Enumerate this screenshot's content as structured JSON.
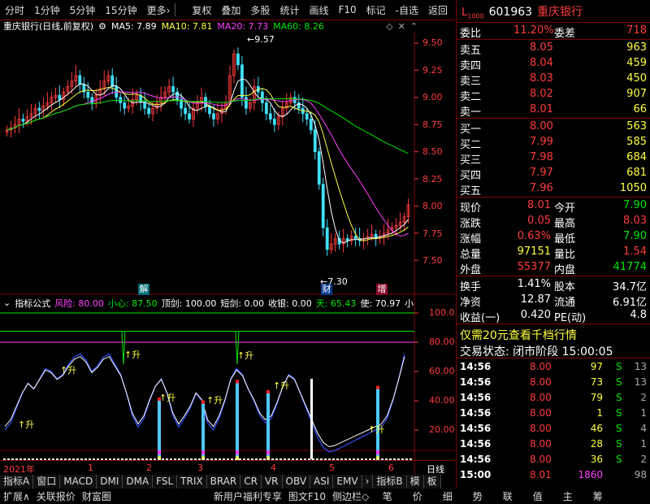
{
  "toolbar": {
    "left": [
      "分时",
      "1分钟",
      "5分钟",
      "15分钟",
      "更多›"
    ],
    "right": [
      "复权",
      "叠加",
      "多股",
      "统计",
      "画线",
      "F10",
      "标记",
      "-自选",
      "返回"
    ]
  },
  "chart": {
    "stock_title": "重庆银行(日线,前复权)",
    "ma5": "MA5: 7.89",
    "ma10": "MA10: 7.81",
    "ma20": "MA20: 7.73",
    "ma60": "MA60: 8.26",
    "high_label": "9.57",
    "low_label": "7.30",
    "price_axis": [
      "9.50",
      "9.25",
      "9.00",
      "8.75",
      "8.50",
      "8.25",
      "8.00",
      "7.75",
      "7.50"
    ],
    "markers": [
      "解",
      "财",
      "增"
    ]
  },
  "indicator": {
    "name": "指标公式",
    "risk": "风险: 80.00",
    "careful": "小心: 87.50",
    "top_sword": "顶剑: 100.00",
    "short_sword": "短剑: 0.00",
    "collect": "收银: 0.00",
    "sky": "天: 65.43",
    "use": "使: 70.97",
    "more": "小",
    "axis": [
      "100.0",
      "80.00",
      "60.00",
      "40.00",
      "20.00"
    ],
    "rise_label": "升"
  },
  "timeline": {
    "year": "2021年",
    "months": [
      "1",
      "2",
      "3",
      "4",
      "5",
      "6"
    ],
    "period": "日线"
  },
  "tabs": [
    "指标A",
    "窗口",
    "MACD",
    "DMI",
    "DMA",
    "FSL",
    "TRIX",
    "BRAR",
    "CR",
    "VR",
    "OBV",
    "ASI",
    "EMV",
    "›",
    "指标B",
    "模",
    "板"
  ],
  "bottom": {
    "left": [
      "扩展∧",
      "关联报价",
      "财富圈"
    ],
    "middle": [
      "新用户福利专享",
      "图文F10",
      "侧边栏◇"
    ],
    "right": [
      "笔",
      "价",
      "细",
      "势",
      "联",
      "值",
      "主",
      "筹"
    ]
  },
  "quote": {
    "code": "601963",
    "name": "重庆银行",
    "wei_bi_label": "委比",
    "wei_bi": "11.20%",
    "wei_cha_label": "委差",
    "wei_cha": "718",
    "sells": [
      {
        "label": "卖五",
        "price": "8.05",
        "vol": "963"
      },
      {
        "label": "卖四",
        "price": "8.04",
        "vol": "459"
      },
      {
        "label": "卖三",
        "price": "8.03",
        "vol": "450"
      },
      {
        "label": "卖二",
        "price": "8.02",
        "vol": "907"
      },
      {
        "label": "卖一",
        "price": "8.01",
        "vol": "66"
      }
    ],
    "buys": [
      {
        "label": "买一",
        "price": "8.00",
        "vol": "563"
      },
      {
        "label": "买二",
        "price": "7.99",
        "vol": "585"
      },
      {
        "label": "买三",
        "price": "7.98",
        "vol": "684"
      },
      {
        "label": "买四",
        "price": "7.97",
        "vol": "681"
      },
      {
        "label": "买五",
        "price": "7.96",
        "vol": "1050"
      }
    ],
    "stats": [
      {
        "l1": "现价",
        "v1": "8.01",
        "l2": "今开",
        "v2": "7.90"
      },
      {
        "l1": "涨跌",
        "v1": "0.05",
        "l2": "最高",
        "v2": "8.03"
      },
      {
        "l1": "涨幅",
        "v1": "0.63%",
        "l2": "最低",
        "v2": "7.90"
      },
      {
        "l1": "总量",
        "v1": "97151",
        "l2": "量比",
        "v2": "1.54"
      },
      {
        "l1": "外盘",
        "v1": "55377",
        "l2": "内盘",
        "v2": "41774"
      }
    ],
    "stats2": [
      {
        "l1": "换手",
        "v1": "1.41%",
        "l2": "股本",
        "v2": "34.7亿"
      },
      {
        "l1": "净资",
        "v1": "12.87",
        "l2": "流通",
        "v2": "6.91亿"
      },
      {
        "l1": "收益(一)",
        "v1": "0.420",
        "l2": "PE(动)",
        "v2": "4.8"
      }
    ],
    "promo": "仅需20元查看千档行情",
    "status": "交易状态: 闭市阶段 15:00:05",
    "trades": [
      {
        "t": "14:56",
        "p": "8.00",
        "v": "97",
        "s": "S",
        "n": "13"
      },
      {
        "t": "14:56",
        "p": "8.00",
        "v": "73",
        "s": "S",
        "n": "13"
      },
      {
        "t": "14:56",
        "p": "8.00",
        "v": "79",
        "s": "S",
        "n": "2"
      },
      {
        "t": "14:56",
        "p": "8.00",
        "v": "1",
        "s": "S",
        "n": "1"
      },
      {
        "t": "14:56",
        "p": "8.00",
        "v": "46",
        "s": "S",
        "n": "4"
      },
      {
        "t": "14:56",
        "p": "8.00",
        "v": "28",
        "s": "S",
        "n": "1"
      },
      {
        "t": "14:56",
        "p": "8.00",
        "v": "36",
        "s": "S",
        "n": "2"
      },
      {
        "t": "15:00",
        "p": "8.01",
        "v": "1860",
        "s": "",
        "n": "98"
      }
    ]
  }
}
